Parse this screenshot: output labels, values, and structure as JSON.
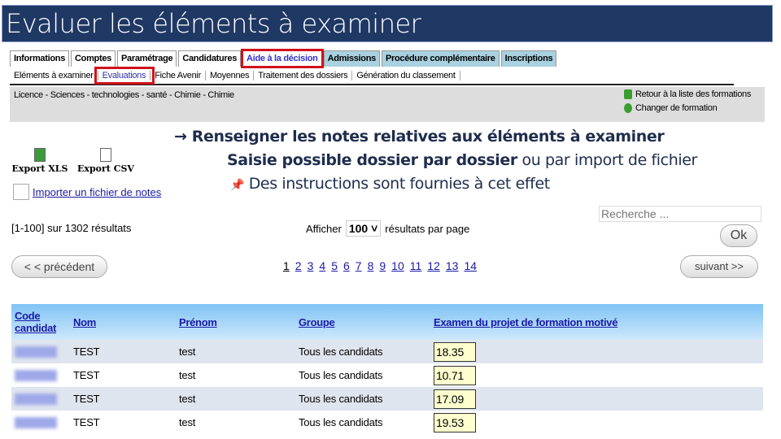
{
  "title": "Evaluer les éléments à examiner",
  "tabs": [
    {
      "label": "Informations"
    },
    {
      "label": "Comptes"
    },
    {
      "label": "Paramétrage"
    },
    {
      "label": "Candidatures"
    },
    {
      "label": "Aide à la décision"
    },
    {
      "label": "Admissions"
    },
    {
      "label": "Procédure complémentaire"
    },
    {
      "label": "Inscriptions"
    }
  ],
  "subtabs": [
    {
      "label": "Eléments à examiner"
    },
    {
      "label": "Evaluations"
    },
    {
      "label": "Fiche Avenir"
    },
    {
      "label": "Moyennes"
    },
    {
      "label": "Traitement des dossiers"
    },
    {
      "label": "Génération du classement"
    }
  ],
  "formation": "Licence - Sciences - technologies - santé - Chimie - Chimie",
  "links": {
    "retour": "Retour à la liste des formations",
    "changer": "Changer de formation"
  },
  "annotations": {
    "line1": "Renseigner les notes relatives aux éléments à examiner",
    "line2_bold": "Saisie possible dossier par dossier",
    "line2_rest": " ou par import de fichier",
    "line3": "Des instructions sont fournies à cet effet"
  },
  "export": {
    "xls": "Export XLS",
    "csv": "Export CSV",
    "import": "Importer un fichier de notes"
  },
  "results": "[1-100] sur 1302 résultats",
  "afficher": {
    "label": "Afficher",
    "value": "100",
    "suffix": "résultats par page"
  },
  "search": {
    "placeholder": "Recherche ...",
    "ok": "Ok"
  },
  "nav": {
    "prev": "< < précédent",
    "next": "suivant >>"
  },
  "pages": [
    "1",
    "2",
    "3",
    "4",
    "5",
    "6",
    "7",
    "8",
    "9",
    "10",
    "11",
    "12",
    "13",
    "14"
  ],
  "table": {
    "headers": [
      "Code candidat",
      "Nom",
      "Prénom",
      "Groupe",
      "Examen du projet de formation motivé"
    ],
    "rows": [
      {
        "nom": "TEST",
        "prenom": "test",
        "groupe": "Tous les candidats",
        "note": "18.35"
      },
      {
        "nom": "TEST",
        "prenom": "test",
        "groupe": "Tous les candidats",
        "note": "10.71"
      },
      {
        "nom": "TEST",
        "prenom": "test",
        "groupe": "Tous les candidats",
        "note": "17.09"
      },
      {
        "nom": "TEST",
        "prenom": "test",
        "groupe": "Tous les candidats",
        "note": "19.53"
      }
    ]
  }
}
